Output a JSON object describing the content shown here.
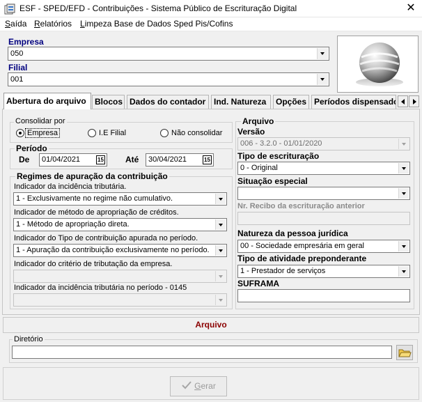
{
  "window": {
    "title": "ESF - SPED/EFD - Contribuições - Sistema Público de Escrituração Digital",
    "close_glyph": "✕"
  },
  "menu": [
    {
      "label": "Saída",
      "underline": "S",
      "rest": "aída"
    },
    {
      "label": "Relatórios",
      "underline": "R",
      "rest": "elatórios"
    },
    {
      "label": "Limpeza Base de Dados Sped Pis/Cofins",
      "underline": "L",
      "rest": "impeza Base de Dados Sped Pis/Cofins"
    }
  ],
  "header": {
    "empresa_label": "Empresa",
    "empresa_value": "050",
    "filial_label": "Filial",
    "filial_value": "001"
  },
  "tabs": [
    {
      "label": "Abertura do arquivo",
      "active": true
    },
    {
      "label": "Blocos",
      "active": false
    },
    {
      "label": "Dados do contador",
      "active": false
    },
    {
      "label": "Ind. Natureza",
      "active": false
    },
    {
      "label": "Opções",
      "active": false
    },
    {
      "label": "Períodos dispensados",
      "active": false
    }
  ],
  "consolidar": {
    "legend": "Consolidar por",
    "options": [
      {
        "label": "Empresa",
        "checked": true
      },
      {
        "label": "I.E Filial",
        "checked": false
      },
      {
        "label": "Não consolidar",
        "checked": false
      }
    ]
  },
  "periodo": {
    "legend": "Período",
    "de_label": "De",
    "de_value": "01/04/2021",
    "ate_label": "Até",
    "ate_value": "30/04/2021",
    "calendar_glyph": "15"
  },
  "regimes": {
    "legend": "Regimes de apuração da contribuição",
    "fields": [
      {
        "label": "Indicador da incidência tributária.",
        "value": "1 - Exclusivamente no regime não cumulativo.",
        "enabled": true
      },
      {
        "label": "Indicador de método de apropriação de créditos.",
        "value": "1 - Método de apropriação direta.",
        "enabled": true
      },
      {
        "label": "Indicador do Tipo de contribuição apurada no período.",
        "value": "1 - Apuração da contribuição exclusivamente no período.",
        "enabled": true
      },
      {
        "label": "Indicador do critério de tributação da empresa.",
        "value": "",
        "enabled": false
      },
      {
        "label": "Indicador da incidência tributária no período  - 0145",
        "value": "",
        "enabled": false
      }
    ]
  },
  "arquivo_group": {
    "legend": "Arquivo",
    "versao_label": "Versão",
    "versao_value": "006 - 3.2.0 - 01/01/2020",
    "tipo_escrituracao_label": "Tipo de escrituração",
    "tipo_escrituracao_value": "0 - Original",
    "situacao_especial_label": "Situação especial",
    "situacao_especial_value": "",
    "nr_recibo_label": "Nr. Recibo da escrituração anterior",
    "nr_recibo_value": "",
    "natureza_label": "Natureza da pessoa jurídica",
    "natureza_value": "00 - Sociedade empresária em geral",
    "tipo_atividade_label": "Tipo de atividade preponderante",
    "tipo_atividade_value": "1 - Prestador de serviços",
    "suframa_label": "SUFRAMA",
    "suframa_value": ""
  },
  "bottom": {
    "arquivo_bar": "Arquivo",
    "diretorio_legend": "Diretório",
    "diretorio_value": "",
    "gerar_label": "Gerar",
    "gerar_underline": "G",
    "gerar_rest": "erar"
  },
  "colors": {
    "label_blue": "#00007f",
    "arquivo_red": "#8b0000",
    "disabled_gray": "#8a8a8a"
  },
  "icons": [
    "app-icon",
    "close-icon",
    "dropdown-arrow-icon",
    "calendar-icon",
    "folder-icon",
    "checkmark-icon",
    "sphere-logo"
  ]
}
